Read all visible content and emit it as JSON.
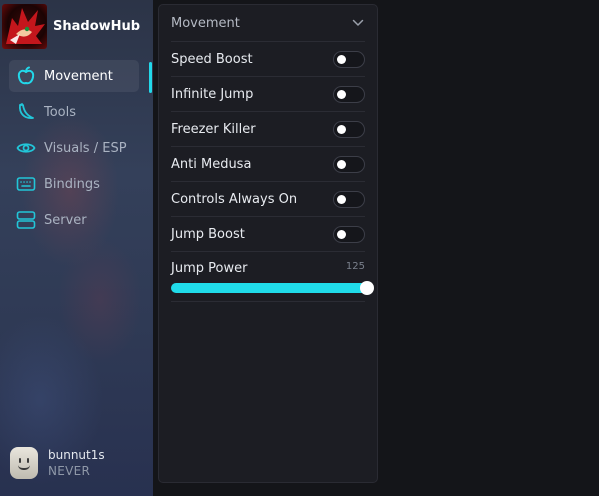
{
  "app": {
    "name": "ShadowHub",
    "accent": "#22d8ea"
  },
  "sidebar": {
    "items": [
      {
        "label": "Movement",
        "icon": "apple-icon",
        "active": true
      },
      {
        "label": "Tools",
        "icon": "banana-icon",
        "active": false
      },
      {
        "label": "Visuals / ESP",
        "icon": "eye-icon",
        "active": false
      },
      {
        "label": "Bindings",
        "icon": "keyboard-icon",
        "active": false
      },
      {
        "label": "Server",
        "icon": "server-icon",
        "active": false
      }
    ]
  },
  "user": {
    "name": "bunnut1s",
    "subtitle": "NEVER"
  },
  "panel": {
    "title": "Movement",
    "toggles": [
      {
        "label": "Speed Boost",
        "on": false
      },
      {
        "label": "Infinite Jump",
        "on": false
      },
      {
        "label": "Freezer Killer",
        "on": false
      },
      {
        "label": "Anti Medusa",
        "on": false
      },
      {
        "label": "Controls Always On",
        "on": false
      },
      {
        "label": "Jump Boost",
        "on": false
      }
    ],
    "slider": {
      "label": "Jump Power",
      "value": "125",
      "fill_fraction": 1.0
    }
  }
}
